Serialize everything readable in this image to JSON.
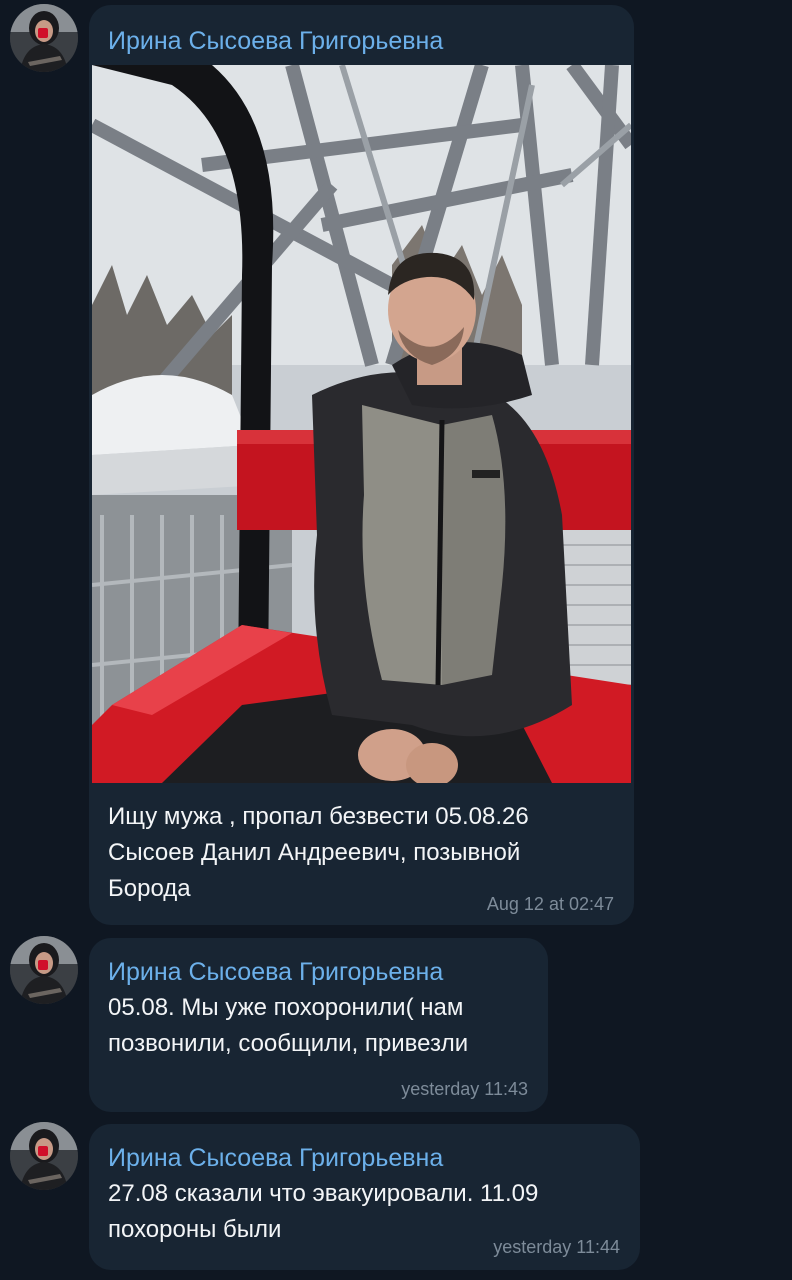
{
  "messages": [
    {
      "sender": "Ирина Сысоева Григорьевна",
      "photo": "photo-man-in-ferris-wheel-cabin",
      "text": "Ищу мужа , пропал безвести 05.08.26\nСысоев Данил Андреевич, позывной\nБорода",
      "time": "Aug 12 at 02:47"
    },
    {
      "sender": "Ирина Сысоева Григорьевна",
      "text": "05.08. Мы уже похоронили( нам\nпозвонили, сообщили, привезли",
      "time": "yesterday 11:43"
    },
    {
      "sender": "Ирина Сысоева Григорьевна",
      "text": "27.08 сказали что эвакуировали. 11.09\nпохороны были",
      "time": "yesterday 11:44"
    }
  ],
  "colors": {
    "background": "#0f1722",
    "bubble": "#182533",
    "sender": "#6cb0ea",
    "text": "#f3f5f7",
    "time": "#7d8b99"
  }
}
